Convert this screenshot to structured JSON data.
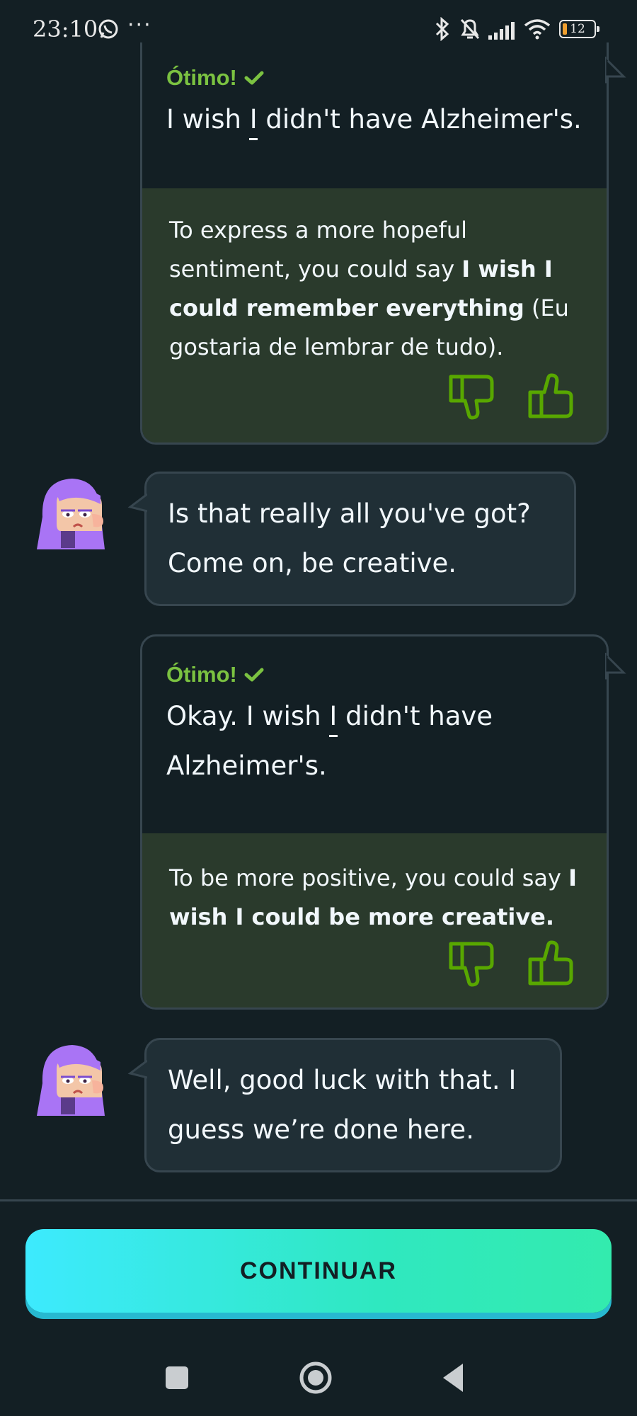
{
  "status_bar": {
    "time": "23:10",
    "dots": "···",
    "battery": "12",
    "icons": [
      "whatsapp-icon",
      "bluetooth-icon",
      "bell-muted-icon",
      "signal-icon",
      "wifi-icon",
      "battery-icon"
    ]
  },
  "messages": [
    {
      "type": "user",
      "status": "Ótimo!",
      "text_before": "I wish ",
      "text_highlight": "I",
      "text_after": " didn't have Alzheimer's.",
      "feedback": {
        "pre": "To express a more hopeful sentiment, you could say ",
        "bold": "I wish I could remember everything",
        "post": " (Eu gostaria de lembrar de tudo)."
      }
    },
    {
      "type": "tutor",
      "text": "Is that really all you've got? Come on, be creative."
    },
    {
      "type": "user",
      "status": "Ótimo!",
      "text_before": "Okay. I wish ",
      "text_highlight": "I",
      "text_after": " didn't have Alzheimer's.",
      "feedback": {
        "pre": "To be more positive, you could say ",
        "bold": "I wish I could be more creative.",
        "post": ""
      }
    },
    {
      "type": "tutor",
      "text": "Well, good luck with that. I guess we’re done here."
    }
  ],
  "continue_button": {
    "label": "CONTINUAR"
  },
  "colors": {
    "background": "#131f24",
    "bubble_border": "#37464f",
    "tutor_bubble": "#202f36",
    "feedback_bg": "#2a3a2c",
    "success_green": "#7bc241",
    "button_cyan": "#3deafe",
    "button_mint": "#33ebae",
    "avatar_purple": "#a974f5"
  },
  "nav": {
    "icons": [
      "recents-square-icon",
      "home-circle-icon",
      "back-triangle-icon"
    ]
  }
}
